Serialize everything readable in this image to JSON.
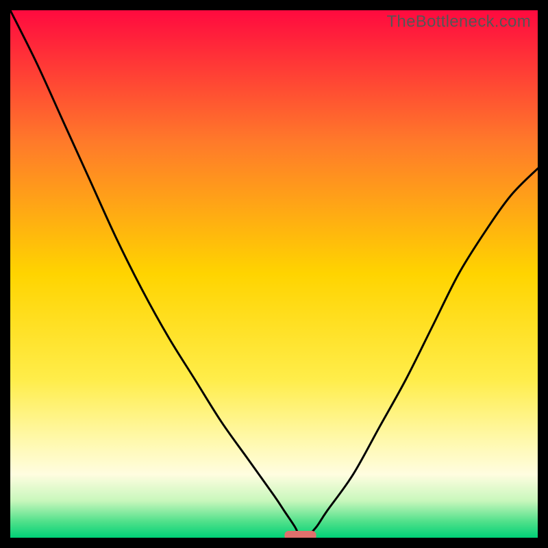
{
  "watermark": "TheBottleneck.com",
  "chart_data": {
    "type": "line",
    "title": "",
    "xlabel": "",
    "ylabel": "",
    "xlim": [
      0,
      100
    ],
    "ylim": [
      0,
      100
    ],
    "x": [
      0,
      5,
      10,
      15,
      20,
      25,
      30,
      35,
      40,
      45,
      50,
      52,
      54,
      55,
      56,
      58,
      60,
      65,
      70,
      75,
      80,
      85,
      90,
      95,
      100
    ],
    "values": [
      100,
      90,
      79,
      68,
      57,
      47,
      38,
      30,
      22,
      15,
      8,
      5,
      2,
      0,
      0,
      2,
      5,
      12,
      21,
      30,
      40,
      50,
      58,
      65,
      70
    ],
    "marker": {
      "x_start": 52,
      "x_end": 58,
      "y": 0
    },
    "gradient_stops": [
      {
        "offset": 0.0,
        "color": "#ff0a3f"
      },
      {
        "offset": 0.25,
        "color": "#ff7a2a"
      },
      {
        "offset": 0.5,
        "color": "#ffd400"
      },
      {
        "offset": 0.7,
        "color": "#ffed4a"
      },
      {
        "offset": 0.82,
        "color": "#fff9b0"
      },
      {
        "offset": 0.88,
        "color": "#fffde0"
      },
      {
        "offset": 0.93,
        "color": "#c8f7bc"
      },
      {
        "offset": 0.97,
        "color": "#4fe08a"
      },
      {
        "offset": 1.0,
        "color": "#00d176"
      }
    ],
    "marker_color": "#e0706c",
    "curve_color": "#000000"
  }
}
